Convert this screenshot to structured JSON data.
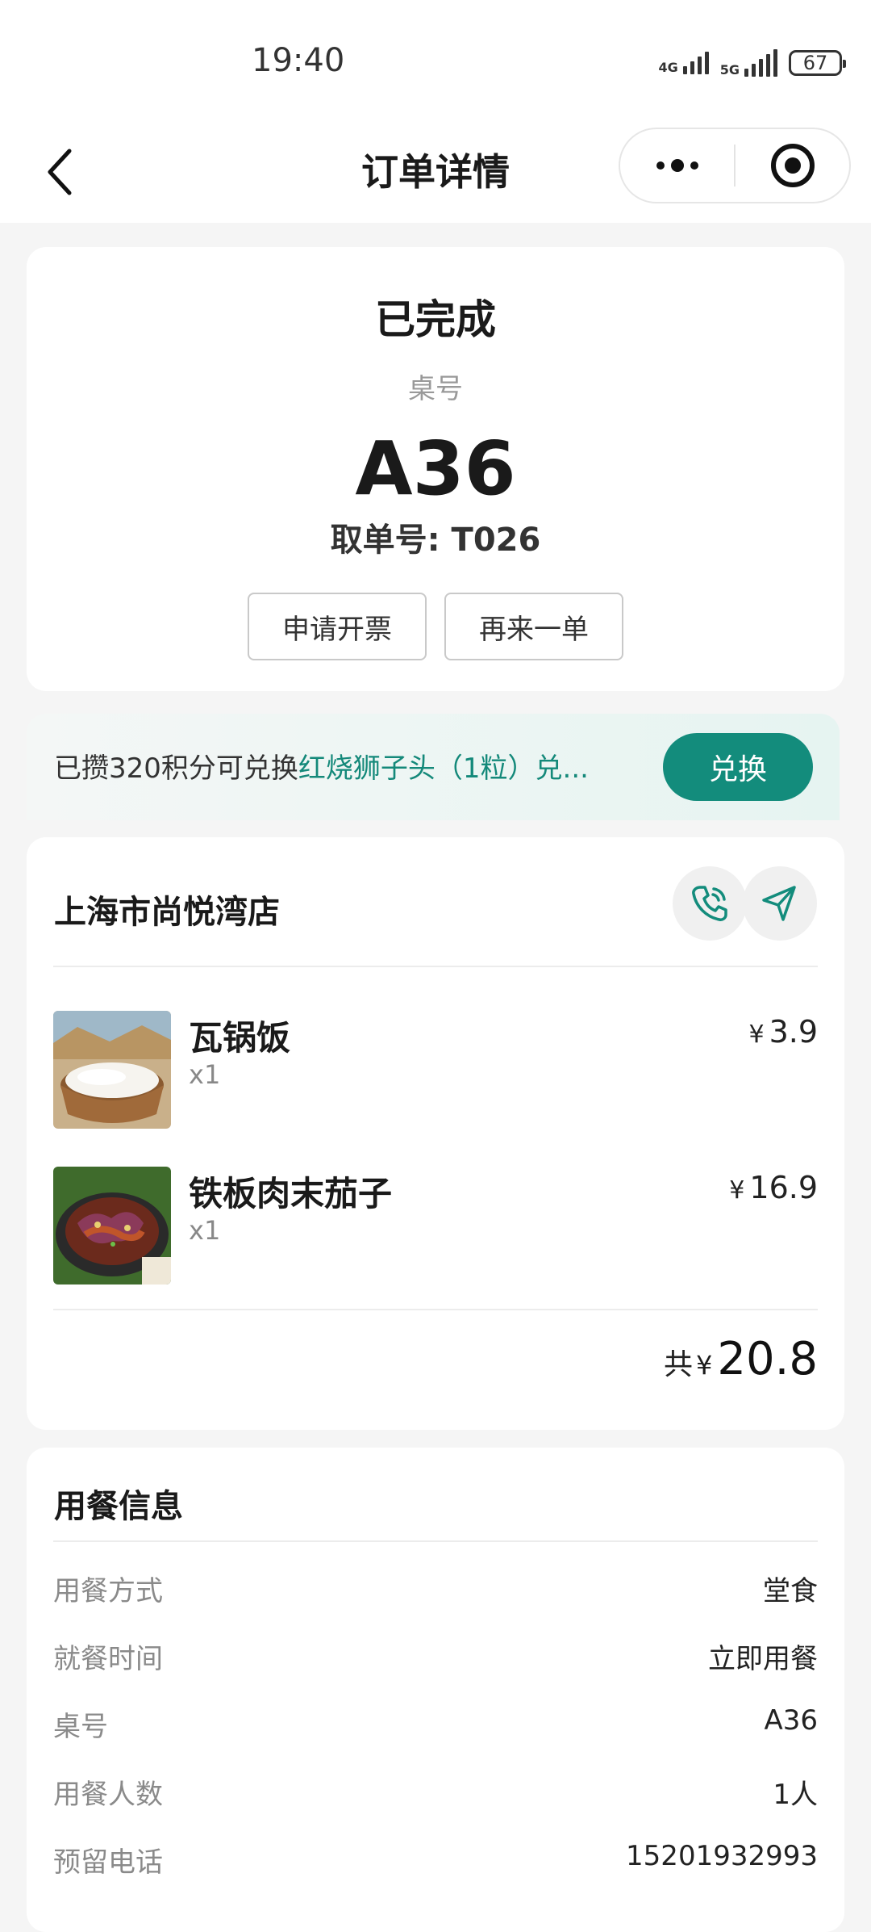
{
  "status_bar": {
    "time": "19:40",
    "network_1": "4G",
    "network_2": "5G",
    "battery": "67"
  },
  "nav": {
    "title": "订单详情",
    "back_icon": "chevron-left-icon",
    "more_icon": "more-dots-icon",
    "close_icon": "target-close-icon"
  },
  "order": {
    "status": "已完成",
    "table_label": "桌号",
    "table_no": "A36",
    "pickup_no": "取单号: T026",
    "invoice_button": "申请开票",
    "reorder_button": "再来一单"
  },
  "points": {
    "text_prefix": "已攒320积分可兑换",
    "text_highlight": "红烧狮子头（1粒）兑...",
    "redeem_button": "兑换",
    "accent_color": "#138c7c"
  },
  "store": {
    "name": "上海市尚悦湾店",
    "phone_icon": "phone-icon",
    "navigate_icon": "navigation-arrow-icon",
    "items": [
      {
        "name": "瓦锅饭",
        "qty": "x1",
        "currency": "¥",
        "price": "3.9"
      },
      {
        "name": "铁板肉末茄子",
        "qty": "x1",
        "currency": "¥",
        "price": "16.9"
      }
    ],
    "total_label": "共",
    "total_currency": "¥",
    "total_amount": "20.8"
  },
  "dining_info": {
    "title": "用餐信息",
    "rows": [
      {
        "label": "用餐方式",
        "value": "堂食"
      },
      {
        "label": "就餐时间",
        "value": "立即用餐"
      },
      {
        "label": "桌号",
        "value": "A36"
      },
      {
        "label": "用餐人数",
        "value": "1人"
      },
      {
        "label": "预留电话",
        "value": "15201932993"
      }
    ]
  }
}
